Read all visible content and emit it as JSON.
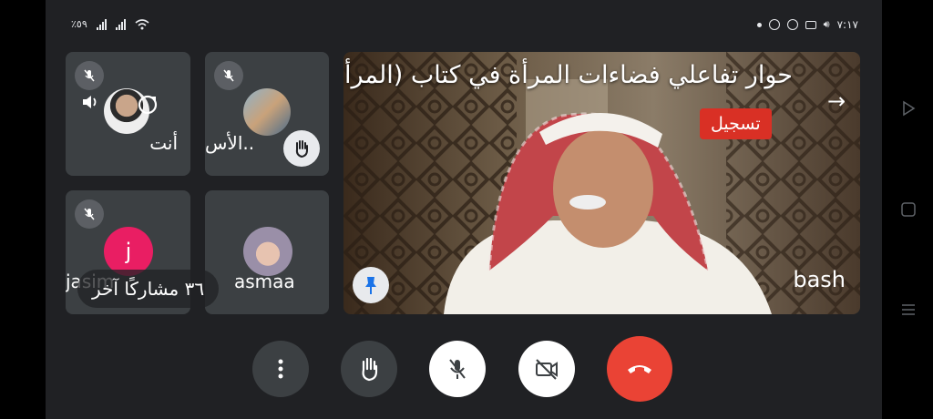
{
  "status_bar": {
    "left_text": "٪٥٩",
    "time": "٧:١٧"
  },
  "main_video": {
    "title": "حوار تفاعلي فضاءات المرأة في كتاب (المرأة والل...",
    "recording_label": "تسجيل",
    "participant_name": "bash"
  },
  "tiles": [
    {
      "name": "أنت",
      "muted": true
    },
    {
      "name": "الأس..",
      "muted": true,
      "hand_raised": true
    },
    {
      "name": "jasim",
      "avatar_letter": "j",
      "muted": true
    },
    {
      "name": "asmaa",
      "muted": false
    }
  ],
  "others_label": "٣٦ مشاركًا آخر",
  "colors": {
    "background": "#202124",
    "tile": "#3c4043",
    "end_call": "#ea4335",
    "recording": "#d93025",
    "avatar_j": "#e91e63"
  },
  "controls": [
    {
      "icon": "more-vertical-icon"
    },
    {
      "icon": "raise-hand-icon"
    },
    {
      "icon": "mic-off-icon"
    },
    {
      "icon": "camera-off-icon"
    },
    {
      "icon": "end-call-icon"
    }
  ]
}
